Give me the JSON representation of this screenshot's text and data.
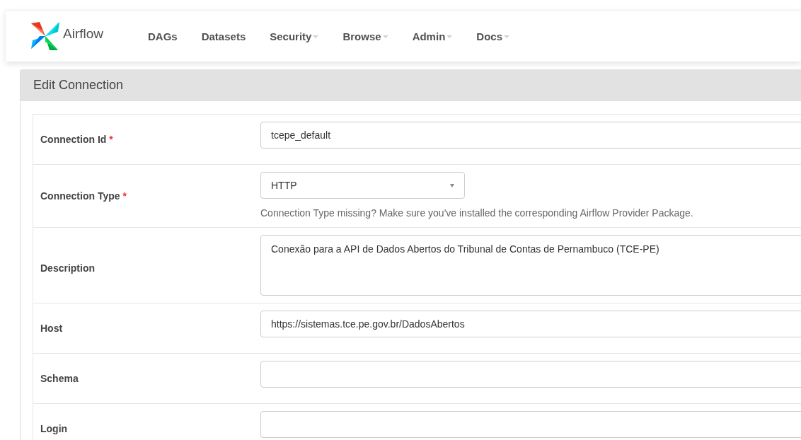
{
  "navbar": {
    "brand": "Airflow",
    "items": [
      {
        "label": "DAGs",
        "dropdown": false
      },
      {
        "label": "Datasets",
        "dropdown": false
      },
      {
        "label": "Security",
        "dropdown": true
      },
      {
        "label": "Browse",
        "dropdown": true
      },
      {
        "label": "Admin",
        "dropdown": true
      },
      {
        "label": "Docs",
        "dropdown": true
      }
    ]
  },
  "panel": {
    "title": "Edit Connection"
  },
  "fields": [
    {
      "label": "Connection Id",
      "required_mark": "*",
      "kind": "text",
      "value": "tcepe_default"
    },
    {
      "label": "Connection Type",
      "required_mark": "*",
      "kind": "select",
      "value": "HTTP",
      "help": "Connection Type missing? Make sure you've installed the corresponding Airflow Provider Package."
    },
    {
      "label": "Description",
      "kind": "textarea",
      "value": "Conexão para a API de Dados Abertos do Tribunal de Contas de Pernambuco (TCE-PE)"
    },
    {
      "label": "Host",
      "kind": "text",
      "value": "https://sistemas.tce.pe.gov.br/DadosAbertos"
    },
    {
      "label": "Schema",
      "kind": "text"
    },
    {
      "label": "Login",
      "kind": "text"
    }
  ]
}
